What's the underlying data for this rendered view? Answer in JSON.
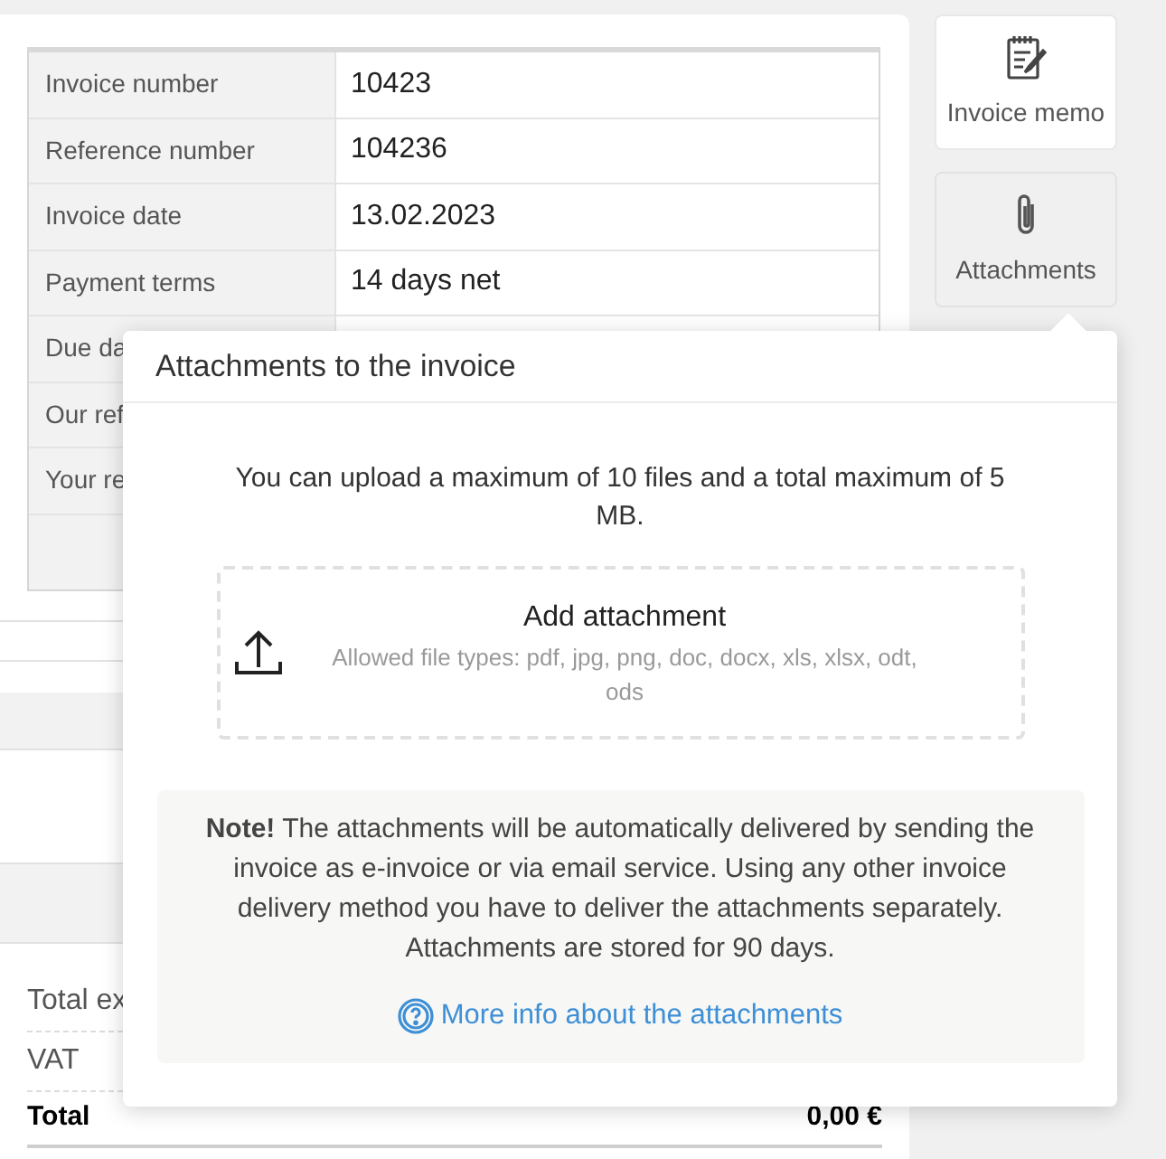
{
  "invoice_details": [
    {
      "label": "Invoice number",
      "value": "10423"
    },
    {
      "label": "Reference number",
      "value": "104236"
    },
    {
      "label": "Invoice date",
      "value": "13.02.2023"
    },
    {
      "label": "Payment terms",
      "value": "14 days net"
    },
    {
      "label": "Due da"
    },
    {
      "label": "Our ref"
    },
    {
      "label": "Your re"
    }
  ],
  "side_buttons": [
    {
      "label": "Invoice memo",
      "kind": "memo",
      "selected": false
    },
    {
      "label": "Attachments",
      "kind": "attachments",
      "selected": true
    }
  ],
  "popup": {
    "title": "Attachments to the invoice",
    "limit_text": "You can upload a maximum of 10 files and a total maximum of 5 MB.",
    "dropzone": {
      "title": "Add attachment",
      "hint": "Allowed file types: pdf, jpg, png, doc, docx, xls, xlsx, odt, ods"
    },
    "note": "**Note!** The attachments will be automatically delivered by sending the invoice as e-invoice or via email service. Using any other invoice delivery method you have to deliver the attachments separately. Attachments are stored for 90 days.",
    "link": "More info about the attachments"
  },
  "totals": [
    {
      "label": "Total ex",
      "kind": "line"
    },
    {
      "label": "VAT",
      "kind": "line"
    },
    {
      "label": "Total",
      "kind": "grand",
      "value": "0,00 €"
    }
  ]
}
